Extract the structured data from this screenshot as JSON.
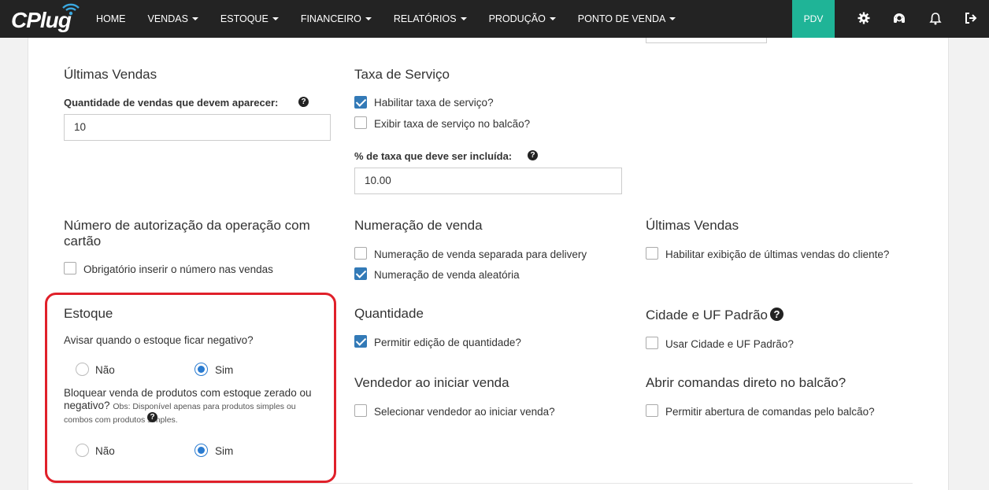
{
  "brand": {
    "logo_text": "CPlug"
  },
  "nav": {
    "items": [
      "HOME",
      "VENDAS",
      "ESTOQUE",
      "FINANCEIRO",
      "RELATÓRIOS",
      "PRODUÇÃO",
      "PONTO DE VENDA"
    ],
    "pdv_label": "PDV"
  },
  "top_icons": [
    "gear-icon",
    "headset-icon",
    "bell-icon",
    "logout-icon"
  ],
  "ultimas_vendas_qty": {
    "title": "Últimas Vendas",
    "label": "Quantidade de vendas que devem aparecer:",
    "value": "10"
  },
  "taxa_servico": {
    "title": "Taxa de Serviço",
    "opt1": "Habilitar taxa de serviço?",
    "opt1_checked": true,
    "opt2": "Exibir taxa de serviço no balcão?",
    "opt2_checked": false,
    "pct_label": "% de taxa que deve ser incluída:",
    "pct_value": "10.00"
  },
  "autorizacao": {
    "title": "Número de autorização da operação com cartão",
    "opt1": "Obrigatório inserir o número nas vendas",
    "opt1_checked": false
  },
  "numeracao": {
    "title": "Numeração de venda",
    "opt1": "Numeração de venda separada para delivery",
    "opt1_checked": false,
    "opt2": "Numeração de venda aleatória",
    "opt2_checked": true
  },
  "ultimas_vendas_cliente": {
    "title": "Últimas Vendas",
    "opt1": "Habilitar exibição de últimas vendas do cliente?",
    "opt1_checked": false
  },
  "estoque": {
    "title": "Estoque",
    "q1": "Avisar quando o estoque ficar negativo?",
    "q1_no": "Não",
    "q1_yes": "Sim",
    "q1_value": "Sim",
    "q2": "Bloquear venda de produtos com estoque zerado ou negativo?",
    "q2_obs": "Obs: Disponível apenas para produtos simples ou combos com produtos simples.",
    "q2_no": "Não",
    "q2_yes": "Sim",
    "q2_value": "Sim"
  },
  "quantidade": {
    "title": "Quantidade",
    "opt1": "Permitir edição de quantidade?",
    "opt1_checked": true
  },
  "cidade_uf": {
    "title": "Cidade e UF Padrão",
    "opt1": "Usar Cidade e UF Padrão?",
    "opt1_checked": false
  },
  "vendedor": {
    "title": "Vendedor ao iniciar venda",
    "opt1": "Selecionar vendedor ao iniciar venda?",
    "opt1_checked": false
  },
  "comandas": {
    "title": "Abrir comandas direto no balcão?",
    "opt1": "Permitir abertura de comandas pelo balcão?",
    "opt1_checked": false
  },
  "colors": {
    "topbar": "#232323",
    "pdv": "#1fb497",
    "checkbox": "#337ab7",
    "highlight": "#e0202a"
  }
}
